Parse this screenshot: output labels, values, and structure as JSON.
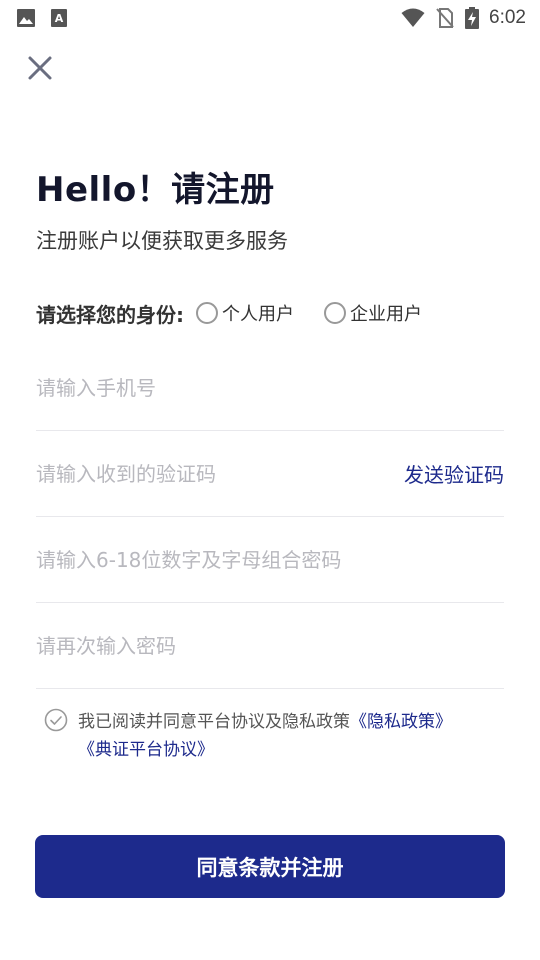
{
  "status_bar": {
    "time": "6:02",
    "left_icons": [
      "image-icon",
      "font-icon"
    ],
    "right_icons": [
      "wifi-icon",
      "no-sim-icon",
      "battery-charging-icon"
    ]
  },
  "header": {
    "close_icon": "close-icon"
  },
  "main": {
    "title": "Hello！请注册",
    "subtitle": "注册账户以便获取更多服务",
    "identity": {
      "label": "请选择您的身份:",
      "options": [
        {
          "label": "个人用户",
          "selected": false
        },
        {
          "label": "企业用户",
          "selected": false
        }
      ]
    },
    "fields": {
      "phone": {
        "placeholder": "请输入手机号",
        "value": ""
      },
      "code": {
        "placeholder": "请输入收到的验证码",
        "value": "",
        "action": "发送验证码"
      },
      "password": {
        "placeholder": "请输入6-18位数字及字母组合密码",
        "value": ""
      },
      "confirm": {
        "placeholder": "请再次输入密码",
        "value": ""
      }
    },
    "agreement": {
      "text": "我已阅读并同意平台协议及隐私政策",
      "privacy_link": "《隐私政策》",
      "platform_link": "《典证平台协议》",
      "checked": false
    },
    "submit_label": "同意条款并注册"
  },
  "colors": {
    "accent": "#1d2a8c",
    "placeholder": "#b8b8be",
    "divider": "#e8e8ec"
  }
}
